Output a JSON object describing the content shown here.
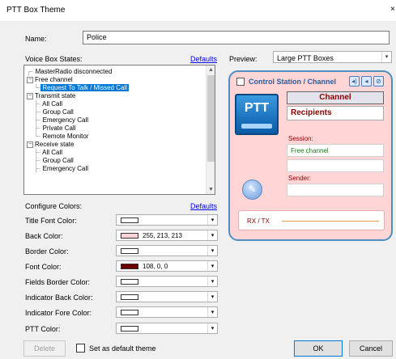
{
  "window": {
    "title": "PTT Box Theme",
    "close_glyph": "×"
  },
  "name": {
    "label": "Name:",
    "value": "Police"
  },
  "voice_box": {
    "label": "Voice Box States:",
    "defaults_link": "Defaults",
    "tree": [
      {
        "text": "MasterRadio disconnected",
        "level": 0,
        "expander": ""
      },
      {
        "text": "Free channel",
        "level": 0,
        "expander": "−"
      },
      {
        "text": "Request To Talk / Missed Call",
        "level": 1,
        "expander": "",
        "selected": true
      },
      {
        "text": "Transmit state",
        "level": 0,
        "expander": "−"
      },
      {
        "text": "All Call",
        "level": 1,
        "expander": ""
      },
      {
        "text": "Group Call",
        "level": 1,
        "expander": ""
      },
      {
        "text": "Emergency Call",
        "level": 1,
        "expander": ""
      },
      {
        "text": "Private Call",
        "level": 1,
        "expander": ""
      },
      {
        "text": "Remote Monitor",
        "level": 1,
        "expander": ""
      },
      {
        "text": "Receive state",
        "level": 0,
        "expander": "−"
      },
      {
        "text": "All Call",
        "level": 1,
        "expander": ""
      },
      {
        "text": "Group Call",
        "level": 1,
        "expander": ""
      },
      {
        "text": "Emergency Call",
        "level": 1,
        "expander": ""
      }
    ]
  },
  "preview": {
    "label": "Preview:",
    "selected": "Large PTT Boxes"
  },
  "configure": {
    "label": "Configure Colors:",
    "defaults_link": "Defaults",
    "rows": [
      {
        "label": "Title Font Color:",
        "swatch": "#ffffff",
        "value": ""
      },
      {
        "label": "Back Color:",
        "swatch": "#ffd5d5",
        "value": "255, 213, 213"
      },
      {
        "label": "Border Color:",
        "swatch": "#ffffff",
        "value": ""
      },
      {
        "label": "Font Color:",
        "swatch": "#6c0000",
        "value": "108, 0, 0"
      },
      {
        "label": "Fields Border Color:",
        "swatch": "#ffffff",
        "value": ""
      },
      {
        "label": "Indicator Back Color:",
        "swatch": "#ffffff",
        "value": ""
      },
      {
        "label": "Indicator Fore Color:",
        "swatch": "#ffffff",
        "value": ""
      },
      {
        "label": "PTT Color:",
        "swatch": "#ffffff",
        "value": ""
      }
    ]
  },
  "ptt_preview": {
    "title": "Control Station / Channel",
    "ptt": "PTT",
    "channel": "Channel",
    "recipients": "Recipients",
    "session_label": "Session:",
    "session_value": "Free channel",
    "sender_label": "Sender:",
    "sender_value": "",
    "rxtx": "RX / TX"
  },
  "footer": {
    "delete": "Delete",
    "set_default": "Set as default theme",
    "ok": "OK",
    "cancel": "Cancel"
  }
}
